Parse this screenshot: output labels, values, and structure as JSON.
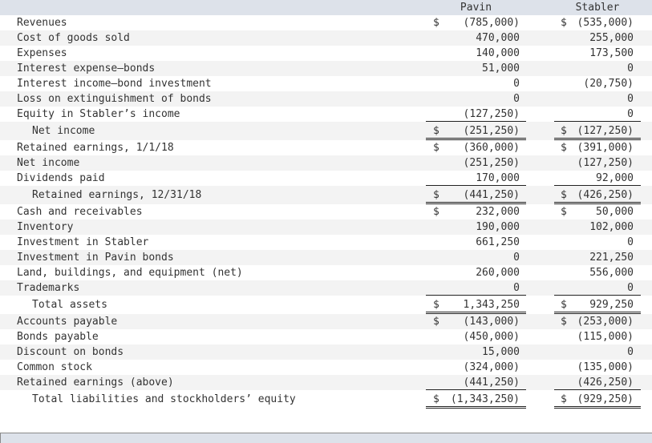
{
  "header": {
    "col_pavin": "Pavin",
    "col_stabler": "Stabler"
  },
  "rows": [
    {
      "label": "Revenues",
      "pavin_dollar": "$",
      "pavin": "(785,000)",
      "stabler_dollar": "$",
      "stabler": "(535,000)"
    },
    {
      "label": "Cost of goods sold",
      "pavin_dollar": "",
      "pavin": "470,000",
      "stabler_dollar": "",
      "stabler": "255,000"
    },
    {
      "label": "Expenses",
      "pavin_dollar": "",
      "pavin": "140,000",
      "stabler_dollar": "",
      "stabler": "173,500"
    },
    {
      "label": "Interest expense—bonds",
      "pavin_dollar": "",
      "pavin": "51,000",
      "stabler_dollar": "",
      "stabler": "0"
    },
    {
      "label": "Interest income—bond investment",
      "pavin_dollar": "",
      "pavin": "0",
      "stabler_dollar": "",
      "stabler": "(20,750)"
    },
    {
      "label": "Loss on extinguishment of bonds",
      "pavin_dollar": "",
      "pavin": "0",
      "stabler_dollar": "",
      "stabler": "0"
    },
    {
      "label": "Equity in Stabler’s income",
      "pavin_dollar": "",
      "pavin": "(127,250)",
      "stabler_dollar": "",
      "stabler": "0"
    },
    {
      "label": "Net income",
      "pavin_dollar": "$",
      "pavin": "(251,250)",
      "stabler_dollar": "$",
      "stabler": "(127,250)"
    },
    {
      "label": "Retained earnings, 1/1/18",
      "pavin_dollar": "$",
      "pavin": "(360,000)",
      "stabler_dollar": "$",
      "stabler": "(391,000)"
    },
    {
      "label": "Net income",
      "pavin_dollar": "",
      "pavin": "(251,250)",
      "stabler_dollar": "",
      "stabler": "(127,250)"
    },
    {
      "label": "Dividends paid",
      "pavin_dollar": "",
      "pavin": "170,000",
      "stabler_dollar": "",
      "stabler": "92,000"
    },
    {
      "label": "Retained earnings, 12/31/18",
      "pavin_dollar": "$",
      "pavin": "(441,250)",
      "stabler_dollar": "$",
      "stabler": "(426,250)"
    },
    {
      "label": "Cash and receivables",
      "pavin_dollar": "$",
      "pavin": "232,000",
      "stabler_dollar": "$",
      "stabler": "50,000"
    },
    {
      "label": "Inventory",
      "pavin_dollar": "",
      "pavin": "190,000",
      "stabler_dollar": "",
      "stabler": "102,000"
    },
    {
      "label": "Investment in Stabler",
      "pavin_dollar": "",
      "pavin": "661,250",
      "stabler_dollar": "",
      "stabler": "0"
    },
    {
      "label": "Investment in Pavin bonds",
      "pavin_dollar": "",
      "pavin": "0",
      "stabler_dollar": "",
      "stabler": "221,250"
    },
    {
      "label": "Land, buildings, and equipment (net)",
      "pavin_dollar": "",
      "pavin": "260,000",
      "stabler_dollar": "",
      "stabler": "556,000"
    },
    {
      "label": "Trademarks",
      "pavin_dollar": "",
      "pavin": "0",
      "stabler_dollar": "",
      "stabler": "0"
    },
    {
      "label": "Total assets",
      "pavin_dollar": "$",
      "pavin": "1,343,250",
      "stabler_dollar": "$",
      "stabler": "929,250"
    },
    {
      "label": "Accounts payable",
      "pavin_dollar": "$",
      "pavin": "(143,000)",
      "stabler_dollar": "$",
      "stabler": "(253,000)"
    },
    {
      "label": "Bonds payable",
      "pavin_dollar": "",
      "pavin": "(450,000)",
      "stabler_dollar": "",
      "stabler": "(115,000)"
    },
    {
      "label": "Discount on bonds",
      "pavin_dollar": "",
      "pavin": "15,000",
      "stabler_dollar": "",
      "stabler": "0"
    },
    {
      "label": "Common stock",
      "pavin_dollar": "",
      "pavin": "(324,000)",
      "stabler_dollar": "",
      "stabler": "(135,000)"
    },
    {
      "label": "Retained earnings (above)",
      "pavin_dollar": "",
      "pavin": "(441,250)",
      "stabler_dollar": "",
      "stabler": "(426,250)"
    },
    {
      "label": "Total liabilities and stockholders’ equity",
      "pavin_dollar": "$",
      "pavin": "(1,343,250)",
      "stabler_dollar": "$",
      "stabler": "(929,250)"
    }
  ]
}
